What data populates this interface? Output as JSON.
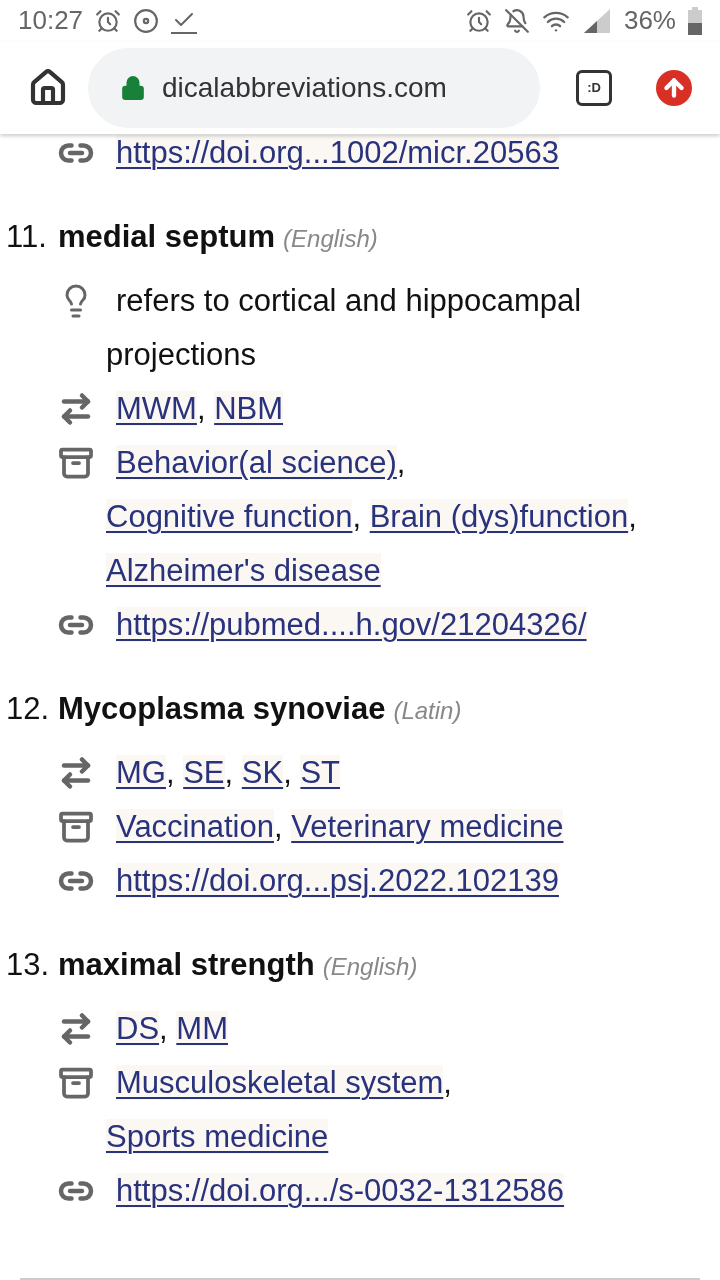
{
  "status_bar": {
    "time": "10:27",
    "battery": "36%"
  },
  "browser": {
    "url": "dicalabbreviations.com",
    "tab_switcher": ":D"
  },
  "separator": ",",
  "previous_link": "https://doi.org...1002/micr.20563",
  "entries": [
    {
      "number": "11.",
      "term": "medial septum",
      "language": "(English)",
      "note": "refers to cortical and hippocampal projections",
      "abbreviations": [
        "MWM",
        "NBM"
      ],
      "categories": [
        "Behavior(al science)",
        "Cognitive function",
        "Brain (dys)function",
        "Alzheimer's disease"
      ],
      "link": "https://pubmed....h.gov/21204326/"
    },
    {
      "number": "12.",
      "term": "Mycoplasma synoviae",
      "language": "(Latin)",
      "abbreviations": [
        "MG",
        "SE",
        "SK",
        "ST"
      ],
      "categories": [
        "Vaccination",
        "Veterinary medicine"
      ],
      "link": "https://doi.org...psj.2022.102139"
    },
    {
      "number": "13.",
      "term": "maximal strength",
      "language": "(English)",
      "abbreviations": [
        "DS",
        "MM"
      ],
      "categories": [
        "Musculoskeletal system",
        "Sports medicine"
      ],
      "link": "https://doi.org.../s-0032-1312586"
    }
  ]
}
